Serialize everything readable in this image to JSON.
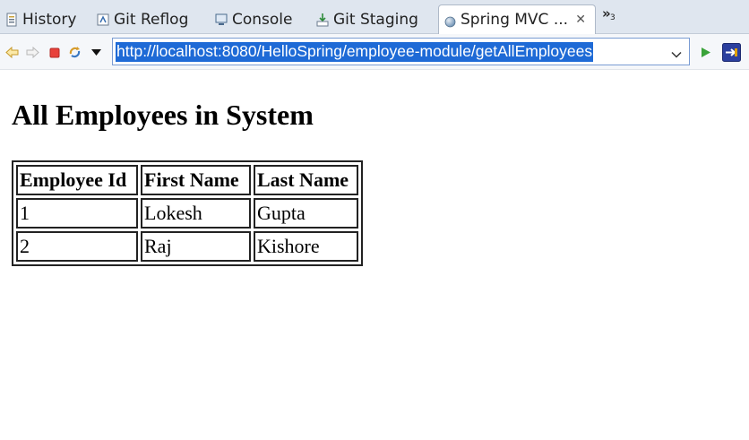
{
  "tabs": [
    {
      "label": "History",
      "icon": "history-icon"
    },
    {
      "label": "Git Reflog",
      "icon": "git-reflog-icon"
    },
    {
      "label": "Console",
      "icon": "console-icon"
    },
    {
      "label": "Git Staging",
      "icon": "git-staging-icon"
    },
    {
      "label": "Spring MVC ...",
      "icon": "globe-icon",
      "active": true
    }
  ],
  "tab_overflow": {
    "count": "3"
  },
  "toolbar": {
    "url": "http://localhost:8080/HelloSpring/employee-module/getAllEmployees"
  },
  "page": {
    "title": "All Employees in System",
    "table": {
      "headers": [
        "Employee Id",
        "First Name",
        "Last Name"
      ],
      "rows": [
        [
          "1",
          "Lokesh",
          "Gupta"
        ],
        [
          "2",
          "Raj",
          "Kishore"
        ]
      ]
    }
  },
  "colors": {
    "tabbar_bg": "#dfe6ef",
    "url_selection": "#1e6ad6",
    "stop_red": "#e8413b",
    "go_green": "#3aa33a"
  }
}
